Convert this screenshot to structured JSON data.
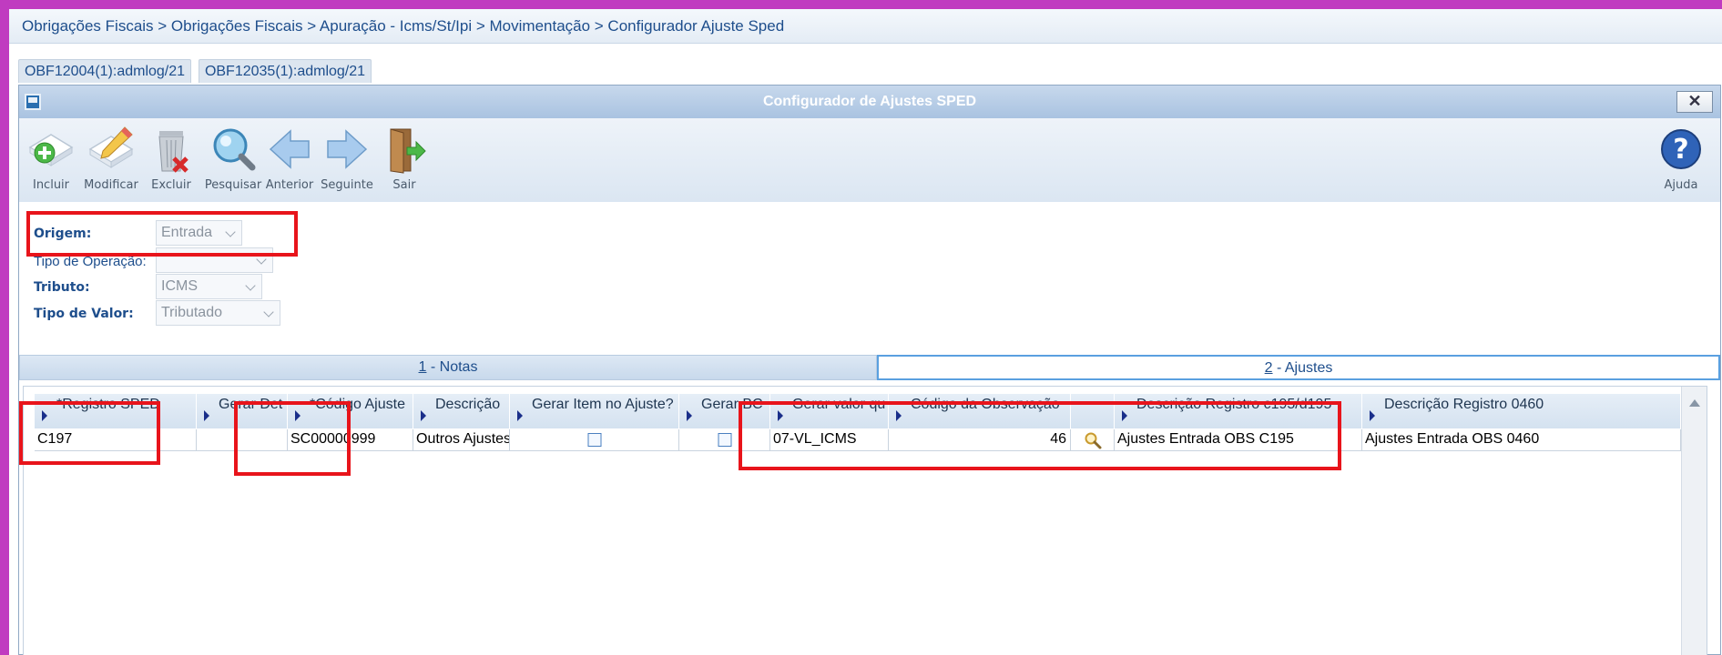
{
  "breadcrumb": "Obrigações Fiscais > Obrigações Fiscais > Apuração - Icms/St/Ipi > Movimentação > Configurador Ajuste Sped",
  "program_tabs": [
    "OBF12004(1):admlog/21",
    "OBF12035(1):admlog/21"
  ],
  "window": {
    "title": "Configurador de Ajustes SPED",
    "close_glyph": "✕"
  },
  "toolbar": {
    "incluir": "Incluir",
    "modificar": "Modificar",
    "excluir": "Excluir",
    "pesquisar": "Pesquisar",
    "anterior": "Anterior",
    "seguinte": "Seguinte",
    "sair": "Sair",
    "ajuda": "Ajuda"
  },
  "form": {
    "origem_label": "Origem:",
    "origem_value": "Entrada",
    "tipo_operacao_label": "Tipo de Operação:",
    "tipo_operacao_value": "",
    "tributo_label": "Tributo:",
    "tributo_value": "ICMS",
    "tipo_valor_label": "Tipo de Valor:",
    "tipo_valor_value": "Tributado"
  },
  "subtabs": {
    "tab1_num": "1",
    "tab1_label": " - Notas",
    "tab2_num": "2",
    "tab2_label": " - Ajustes"
  },
  "grid": {
    "columns": [
      "*Registro SPED",
      "Gerar Det",
      "*Código Ajuste",
      "Descrição",
      "Gerar Item no Ajuste?",
      "Gerar BC",
      "Gerar valor qu",
      "Código da Observação",
      "",
      "Descrição Registro c195/d195",
      "Descrição Registro 0460"
    ],
    "row": {
      "registro_sped": "C197",
      "gerar_det": "",
      "codigo_ajuste": "SC00000999",
      "descricao": "Outros Ajustes",
      "gerar_item_checked": false,
      "gerar_bc_checked": false,
      "gerar_valor": "07-VL_ICMS",
      "codigo_observacao": "46",
      "desc_c195": "Ajustes Entrada OBS C195",
      "desc_0460": "Ajustes Entrada OBS 0460"
    }
  },
  "colors": {
    "highlight": "#e8141b",
    "frame": "#c03bc0",
    "link_text": "#1e4e8c"
  }
}
